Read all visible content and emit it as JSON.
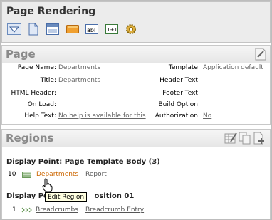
{
  "header": {
    "title": "Page Rendering",
    "toolbar": [
      {
        "name": "collapse-icon"
      },
      {
        "name": "page-icon"
      },
      {
        "name": "region-icon"
      },
      {
        "name": "button-icon"
      },
      {
        "name": "item-icon"
      },
      {
        "name": "computation-icon"
      },
      {
        "name": "gear-icon"
      }
    ]
  },
  "page_section": {
    "title": "Page",
    "fields": {
      "page_name_label": "Page Name:",
      "page_name_value": "Departments",
      "title_label": "Title:",
      "title_value": "Departments",
      "html_header_label": "HTML Header:",
      "on_load_label": "On Load:",
      "help_text_label": "Help Text:",
      "help_text_value": "No help is available for this",
      "template_label": "Template:",
      "template_value": "Application default",
      "header_text_label": "Header Text:",
      "footer_text_label": "Footer Text:",
      "build_option_label": "Build Option:",
      "authorization_label": "Authorization:",
      "authorization_value": "No"
    }
  },
  "regions_section": {
    "title": "Regions",
    "groups": [
      {
        "title": "Display Point: Page Template Body (3)",
        "rows": [
          {
            "seq": "10",
            "name": "Departments",
            "type": "Report"
          }
        ]
      },
      {
        "title": "Display Point: Position 01",
        "title_visible_start": "Display Poin",
        "title_visible_end": "osition 01",
        "rows": [
          {
            "seq": "1",
            "name": "Breadcrumbs",
            "type": "Breadcrumb Entry"
          }
        ]
      }
    ],
    "tooltip": "Edit Region"
  },
  "colors": {
    "link_hover": "#cc6600",
    "link": "#666666",
    "header_bg": "#ececec"
  }
}
